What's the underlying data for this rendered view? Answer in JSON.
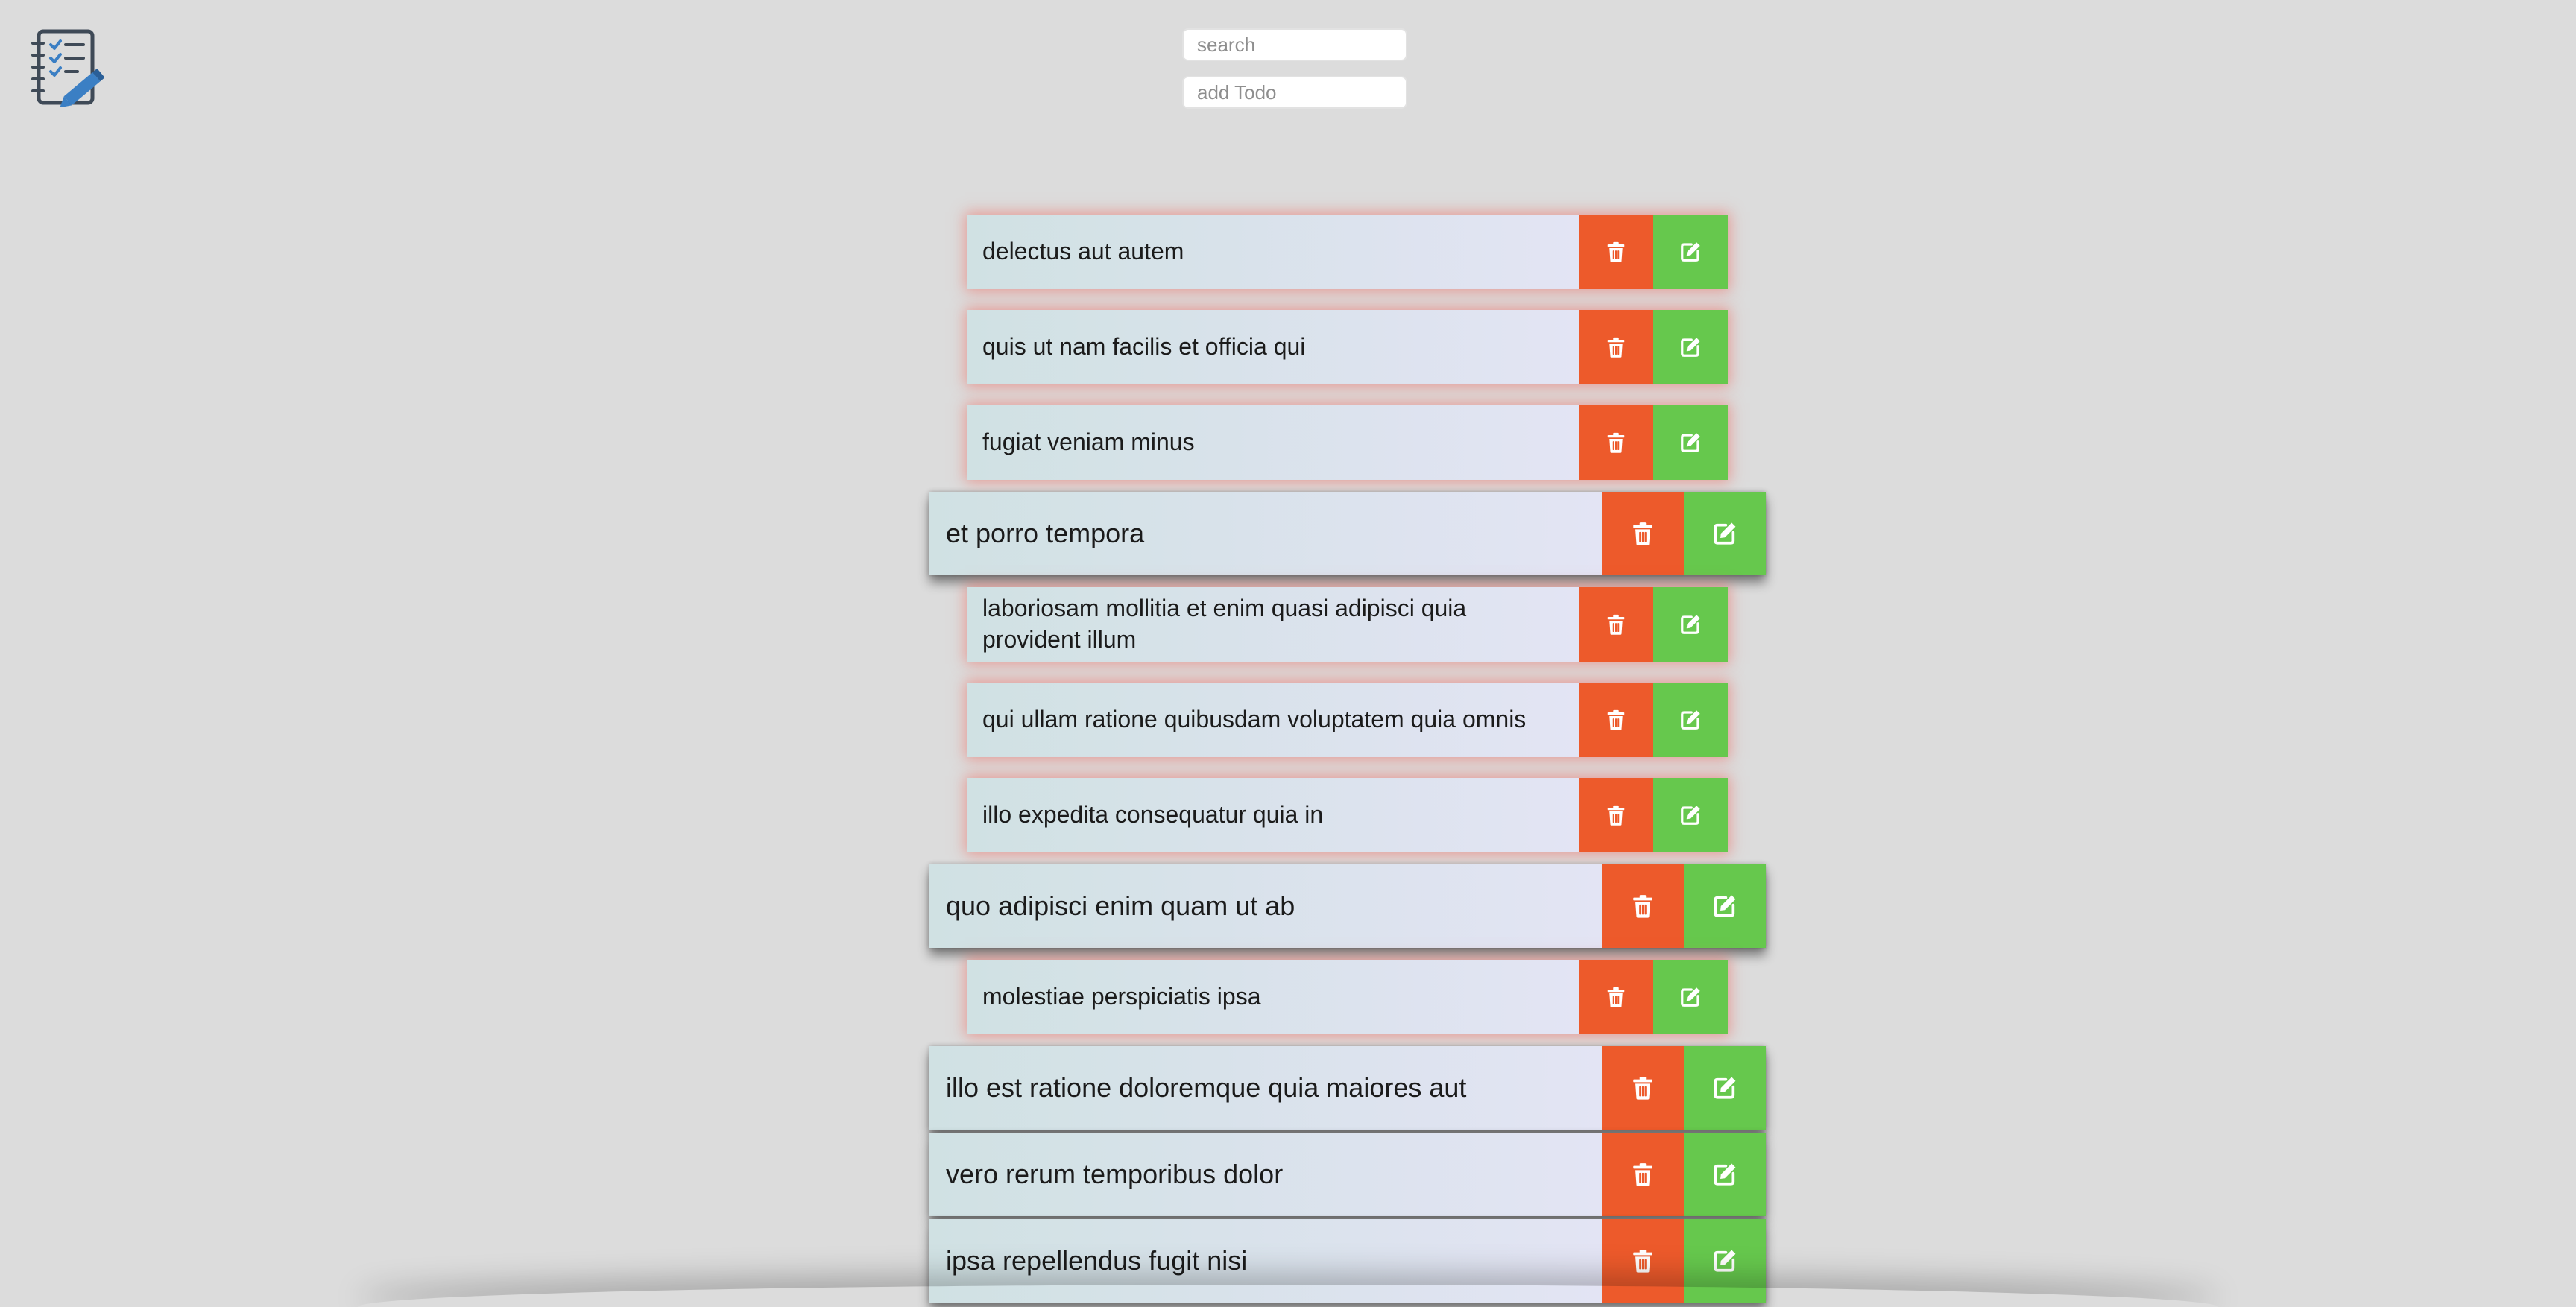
{
  "search": {
    "placeholder": "search"
  },
  "add_todo": {
    "placeholder": "add Todo"
  },
  "icons": {
    "logo": "notebook-checklist-pencil-icon",
    "delete": "trash-icon",
    "edit": "edit-icon"
  },
  "colors": {
    "background": "#dcdcdc",
    "delete": "#ed5a2b",
    "edit": "#66c84d",
    "item_gradient_start": "#d0e1e3",
    "item_gradient_end": "#e3e4f4",
    "pending_glow": "#ee645a"
  },
  "todos": [
    {
      "title": "delectus aut autem",
      "completed": false
    },
    {
      "title": "quis ut nam facilis et officia qui",
      "completed": false
    },
    {
      "title": "fugiat veniam minus",
      "completed": false
    },
    {
      "title": "et porro tempora",
      "completed": true
    },
    {
      "title": "laboriosam mollitia et enim quasi adipisci quia provident illum",
      "completed": false
    },
    {
      "title": "qui ullam ratione quibusdam voluptatem quia omnis",
      "completed": false
    },
    {
      "title": "illo expedita consequatur quia in",
      "completed": false
    },
    {
      "title": "quo adipisci enim quam ut ab",
      "completed": true
    },
    {
      "title": "molestiae perspiciatis ipsa",
      "completed": false
    },
    {
      "title": "illo est ratione doloremque quia maiores aut",
      "completed": true
    },
    {
      "title": "vero rerum temporibus dolor",
      "completed": true
    },
    {
      "title": "ipsa repellendus fugit nisi",
      "completed": true
    }
  ]
}
